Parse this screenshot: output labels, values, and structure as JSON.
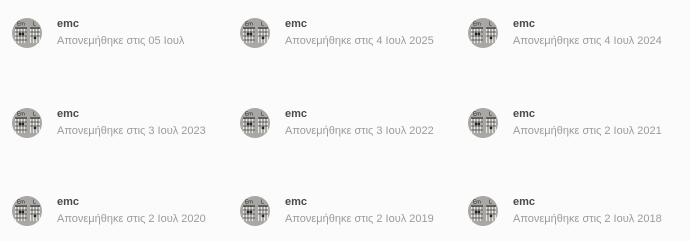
{
  "awards": [
    {
      "name": "emc",
      "subtitle": "Απονεμήθηκε στις 05 Ιουλ"
    },
    {
      "name": "emc",
      "subtitle": "Απονεμήθηκε στις 4 Ιουλ 2025"
    },
    {
      "name": "emc",
      "subtitle": "Απονεμήθηκε στις 4 Ιουλ 2024"
    },
    {
      "name": "emc",
      "subtitle": "Απονεμήθηκε στις 3 Ιουλ 2023"
    },
    {
      "name": "emc",
      "subtitle": "Απονεμήθηκε στις 3 Ιουλ 2022"
    },
    {
      "name": "emc",
      "subtitle": "Απονεμήθηκε στις 2 Ιουλ 2021"
    },
    {
      "name": "emc",
      "subtitle": "Απονεμήθηκε στις 2 Ιουλ 2020"
    },
    {
      "name": "emc",
      "subtitle": "Απονεμήθηκε στις 2 Ιουλ 2019"
    },
    {
      "name": "emc",
      "subtitle": "Απονεμήθηκε στις 2 Ιουλ 2018"
    }
  ],
  "avatar": {
    "chord_labels": [
      "Em",
      "L"
    ],
    "colors": {
      "background": "#a9a7a3",
      "panel": "#e9e7e2",
      "lines": "#3a3a3a"
    }
  }
}
